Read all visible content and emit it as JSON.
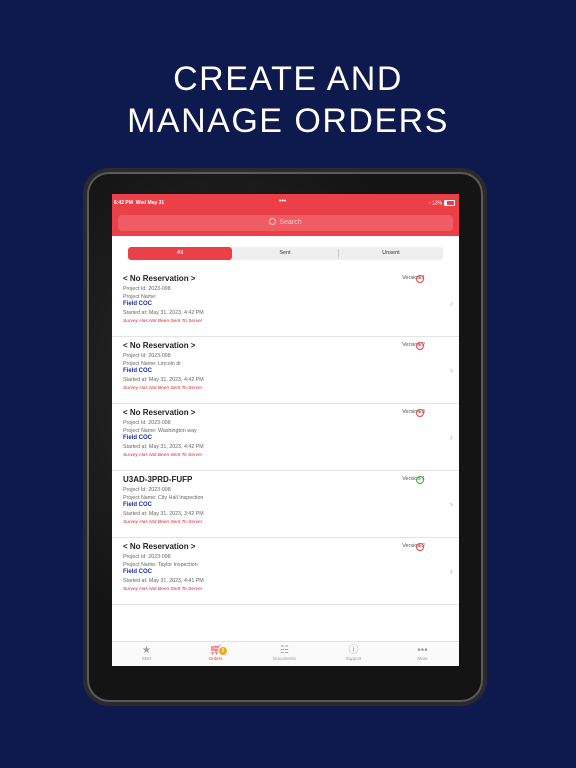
{
  "headline": {
    "line1": "CREATE AND",
    "line2": "MANAGE ORDERS"
  },
  "status_bar": {
    "time": "6:42 PM",
    "date": "Wed May 31",
    "dots": "•••",
    "battery": "13%"
  },
  "search": {
    "placeholder": "Search"
  },
  "segments": {
    "all": "All",
    "sent": "Sent",
    "unsent": "Unsent",
    "selected": "All"
  },
  "orders": [
    {
      "title": "< No Reservation >",
      "version": "Version 1",
      "status": "not-sent",
      "project_id": "Project Id: 2023-098",
      "project_name": "Project Name:",
      "type": "Field COC",
      "started": "Started at: May 31, 2023, 4:42 PM",
      "warning": "Survey Has Not Been Sent To Server"
    },
    {
      "title": "< No Reservation >",
      "version": "Version 2",
      "status": "not-sent",
      "project_id": "Project Id: 2023-098",
      "project_name": "Project Name: Lincoln dr",
      "type": "Field COC",
      "started": "Started at: May 31, 2023, 4:42 PM",
      "warning": "Survey Has Not Been Sent To Server"
    },
    {
      "title": "< No Reservation >",
      "version": "Version 3",
      "status": "not-sent",
      "project_id": "Project Id: 2023-098",
      "project_name": "Project Name: Washington way",
      "type": "Field COC",
      "started": "Started at: May 31, 2023, 4:42 PM",
      "warning": "Survey Has Not Been Sent To Server"
    },
    {
      "title": "U3AD-3PRD-FUFP",
      "version": "Version 1",
      "status": "ok",
      "project_id": "Project Id: 2023-098",
      "project_name": "Project Name: City Hall Inspection",
      "type": "Field COC",
      "started": "Started at: May 31, 2023, 3:42 PM",
      "warning": "Survey Has Not Been Sent To Server"
    },
    {
      "title": "< No Reservation >",
      "version": "Version 2",
      "status": "not-sent",
      "project_id": "Project Id: 2023-098",
      "project_name": "Project Name: Taylor Inspection",
      "type": "Field COC",
      "started": "Started at: May 31, 2023, 4:41 PM",
      "warning": "Survey Has Not Been Sent To Server"
    }
  ],
  "tabbar": {
    "items": [
      {
        "label": "Start",
        "icon": "star-icon"
      },
      {
        "label": "Orders",
        "icon": "cart-icon",
        "badge": "5"
      },
      {
        "label": "Documents",
        "icon": "document-icon"
      },
      {
        "label": "Support",
        "icon": "info-icon"
      },
      {
        "label": "More",
        "icon": "more-icon"
      }
    ],
    "active": "Orders"
  },
  "colors": {
    "accent": "#ec4048",
    "background": "#0e1a4d",
    "link": "#1a2db4",
    "success": "#39a845"
  }
}
